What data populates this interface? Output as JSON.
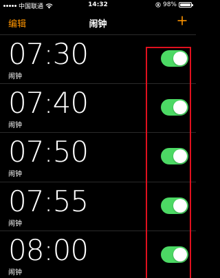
{
  "status_bar": {
    "carrier": "中国联通",
    "time": "14:32",
    "battery": "98%",
    "battery_level": 0.98
  },
  "nav": {
    "edit": "编辑",
    "title": "闹钟",
    "add_icon": "plus-icon"
  },
  "alarms": [
    {
      "time": "07:30",
      "label": "闹钟",
      "enabled": true
    },
    {
      "time": "07:40",
      "label": "闹钟",
      "enabled": true
    },
    {
      "time": "07:50",
      "label": "闹钟",
      "enabled": true
    },
    {
      "time": "07:55",
      "label": "闹钟",
      "enabled": true
    },
    {
      "time": "08:00",
      "label": "闹钟",
      "enabled": true
    }
  ],
  "colors": {
    "accent": "#ff9500",
    "toggle_on": "#4cd964",
    "highlight": "#e0101e"
  }
}
